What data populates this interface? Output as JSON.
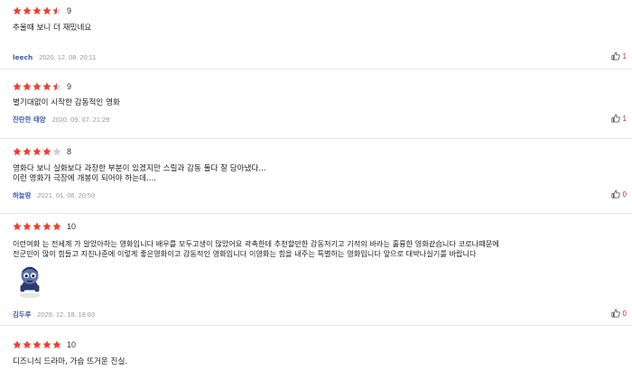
{
  "colors": {
    "star_on": "#f03d2d",
    "star_off": "#cfcfcf",
    "username": "#3f5aa8",
    "like": "#d22222"
  },
  "reviews": [
    {
      "stars": 4.5,
      "score": "9",
      "text": "추울때 보니 더 재밌네요",
      "user": "leech",
      "date": "2020. 12. 08. 20:11",
      "likes": "1"
    },
    {
      "stars": 4.5,
      "score": "9",
      "text": "별기대없이 시작한 감동적인 영화",
      "user": "찬란한 태양",
      "date": "2020. 09. 07. 21:29",
      "likes": "1"
    },
    {
      "stars": 4,
      "score": "8",
      "text": "영화다 보니 실화보다 과장한 부분이 있겠지만 스릴과 감동 둘다 잘 담아냈다...\n이런 영화가 극장에 개봉이 되어야 하는데....",
      "user": "하늘땅",
      "date": "2021. 01. 06. 20:59",
      "likes": "0"
    },
    {
      "stars": 5,
      "score": "10",
      "text": "이런여화 는 전세계 가 알았아하는 영화입니다 배우를 모두고생이 많았어요 곽촉한테 추천할만한 감동저기고 기적의 바라는 훌륭한 영화같습니다 코로나때문에\n전군민이 많이 힘들고 지친나준에 이렇게 좋은영화이고 감동적인 영화입니다 이영화는 힘을 내주는 특별하는 영화입니다 앞으로 대박나실기를 바랍니다",
      "user": "김두루",
      "date": "2020. 12. 18. 18:03",
      "likes": "0",
      "sticker": "character-sticker"
    },
    {
      "stars": 5,
      "score": "10",
      "text": "디즈니식 드라마, 가슴 뜨거운 진실."
    }
  ]
}
